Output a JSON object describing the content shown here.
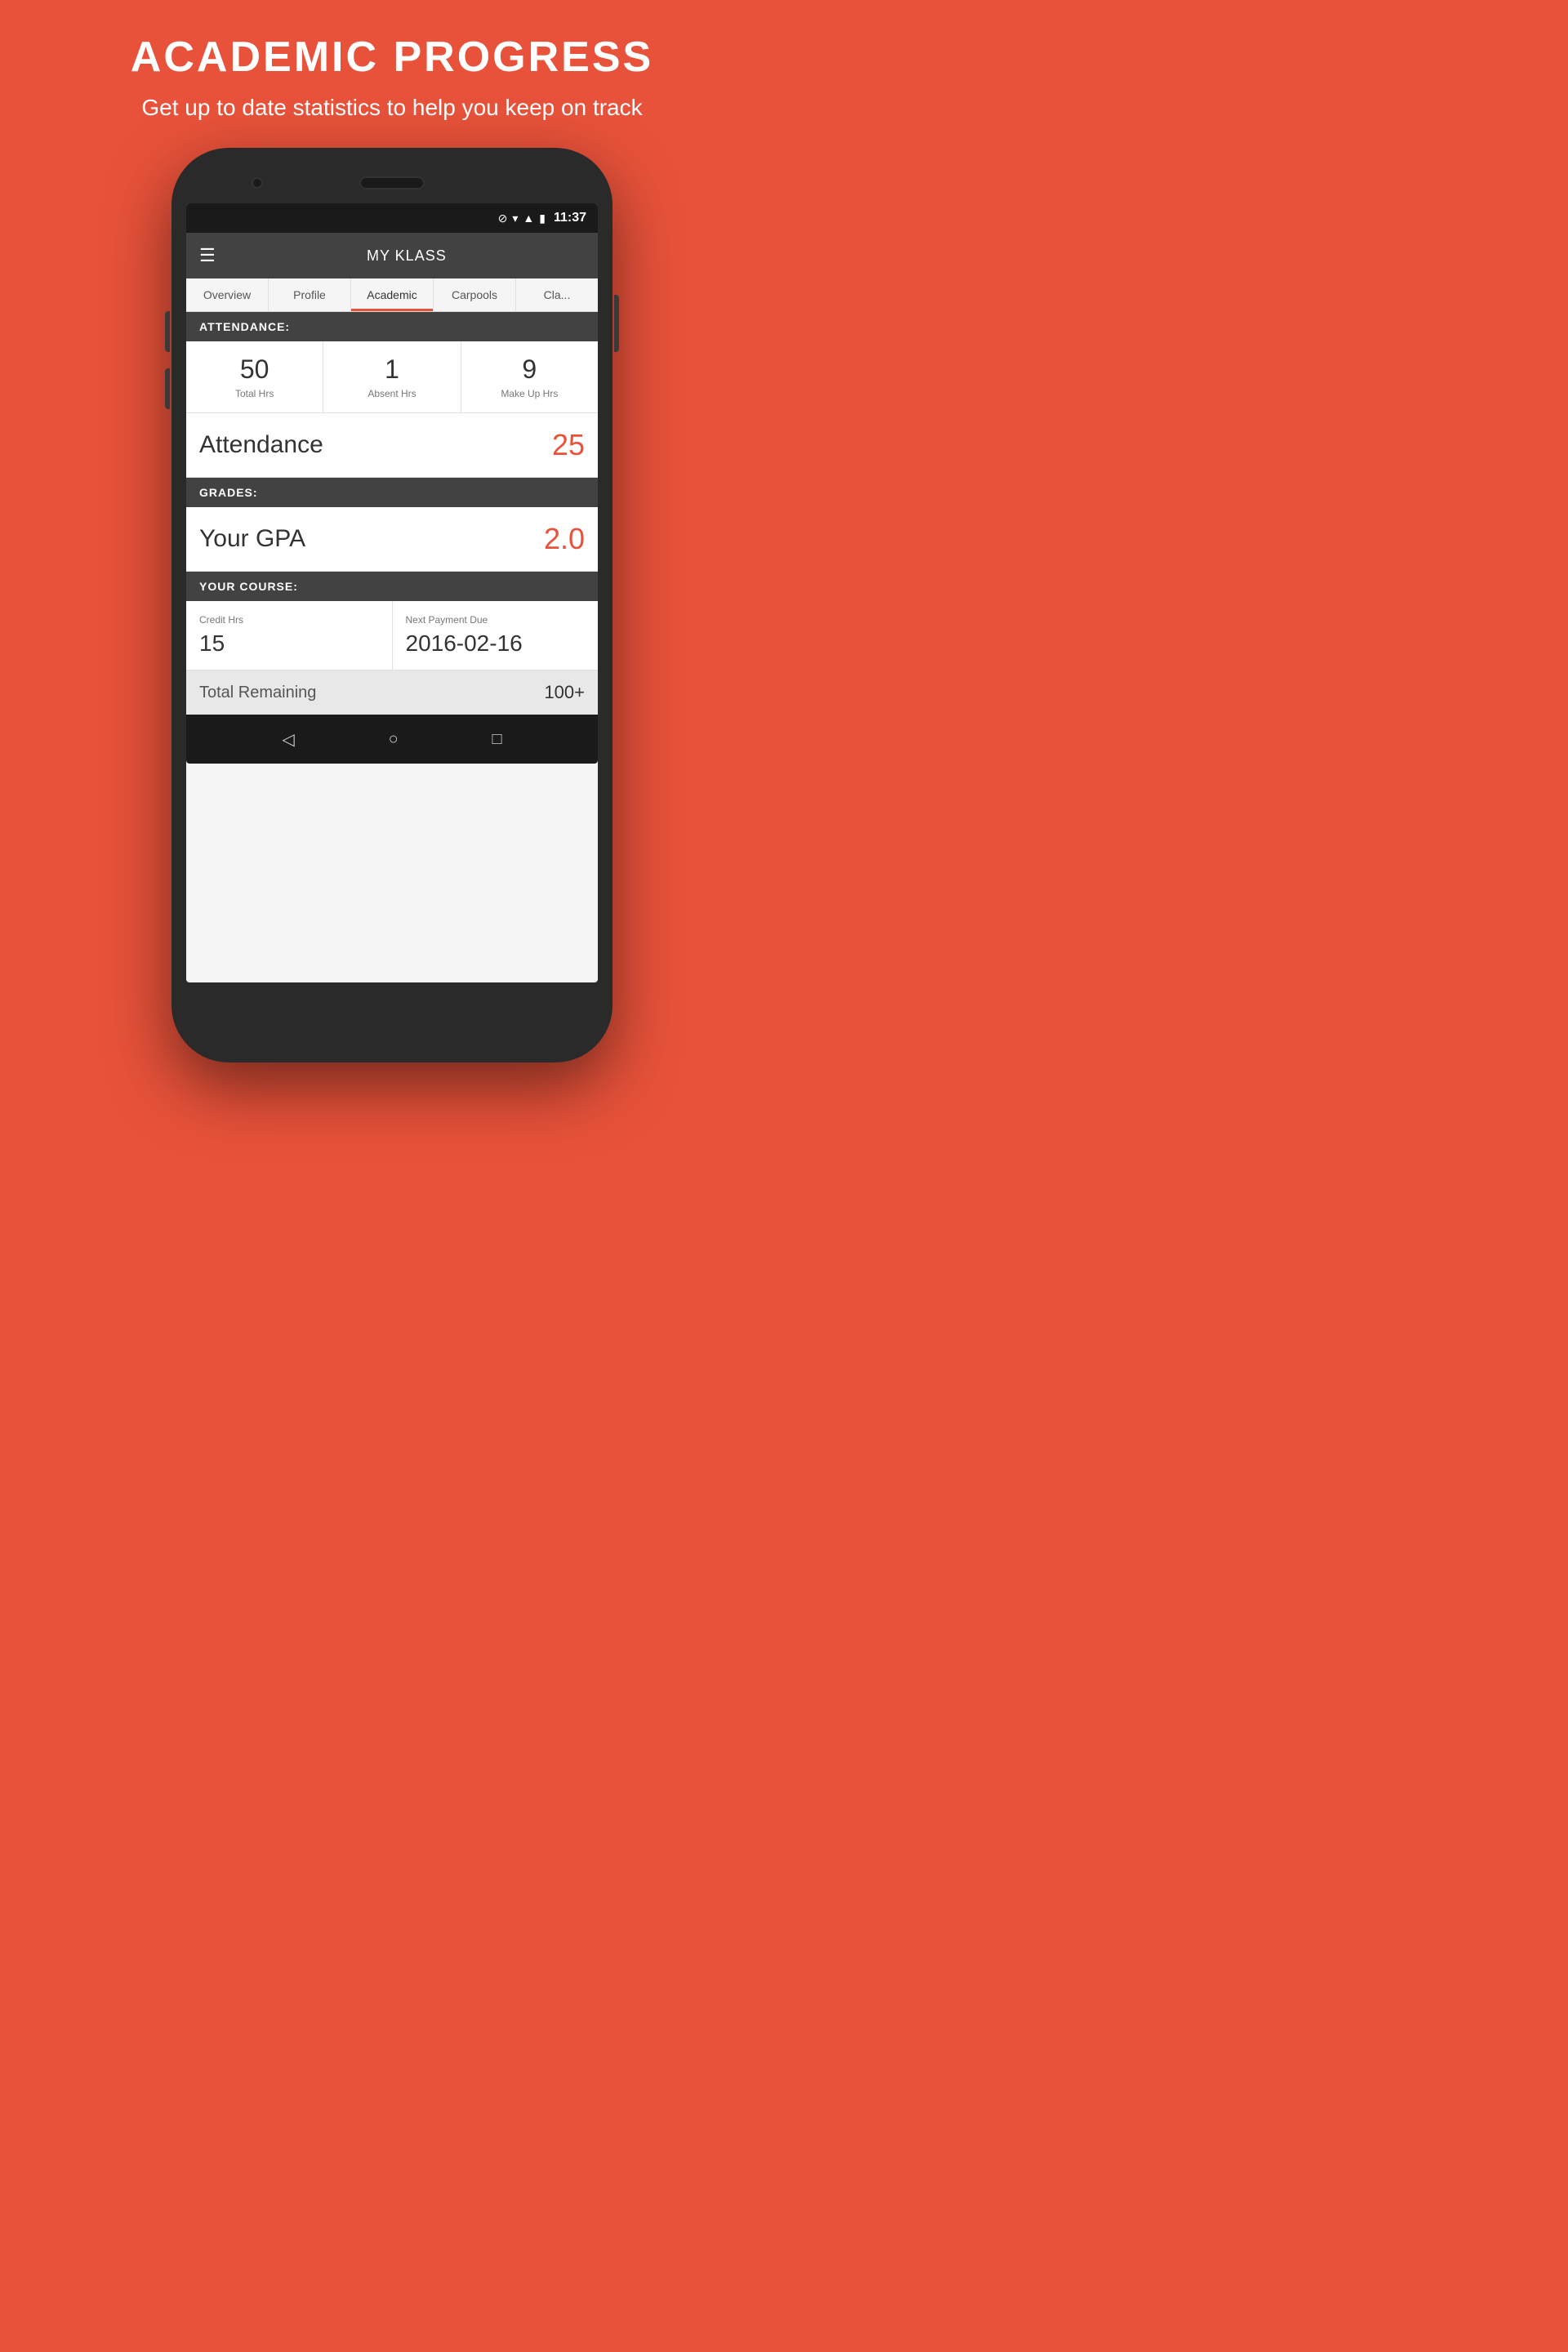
{
  "header": {
    "title": "ACADEMIC PROGRESS",
    "subtitle": "Get up to date statistics to help you keep on track"
  },
  "status_bar": {
    "time": "11:37",
    "icons": [
      "no-sim",
      "wifi",
      "signal",
      "battery"
    ]
  },
  "app_bar": {
    "title": "MY KLASS",
    "menu_icon": "☰"
  },
  "tabs": [
    {
      "label": "Overview",
      "active": false
    },
    {
      "label": "Profile",
      "active": false
    },
    {
      "label": "Academic",
      "active": true
    },
    {
      "label": "Carpools",
      "active": false
    },
    {
      "label": "Cla...",
      "active": false
    }
  ],
  "attendance_section": {
    "header": "ATTENDANCE:",
    "stats": [
      {
        "number": "50",
        "label": "Total Hrs"
      },
      {
        "number": "1",
        "label": "Absent Hrs"
      },
      {
        "number": "9",
        "label": "Make Up Hrs"
      }
    ],
    "metric_label": "Attendance",
    "metric_value": "25"
  },
  "grades_section": {
    "header": "GRADES:",
    "metric_label": "Your GPA",
    "metric_value": "2.0"
  },
  "course_section": {
    "header": "YOUR COURSE:",
    "cells": [
      {
        "label": "Credit Hrs",
        "value": "15"
      },
      {
        "label": "Next Payment Due",
        "value": "2016-02-16"
      }
    ]
  },
  "partial_section": {
    "label": "Total Remaining",
    "value": "100+"
  },
  "nav_buttons": {
    "back": "◁",
    "home": "○",
    "recent": "□"
  },
  "accent_color": "#E8523A"
}
